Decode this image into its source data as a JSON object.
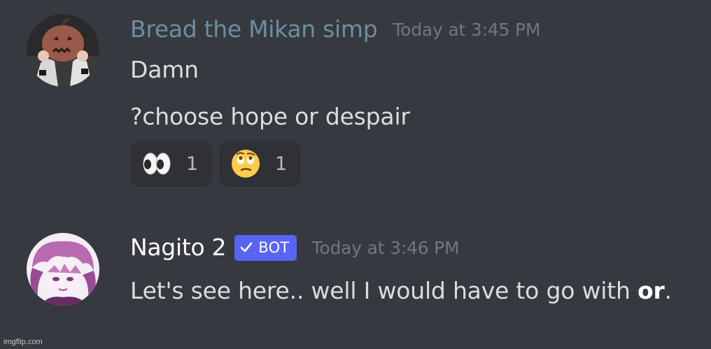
{
  "messages": [
    {
      "author": "Bread the Mikan simp",
      "author_color": "#6d8ea0",
      "timestamp": "Today at 3:45 PM",
      "avatar": "pumpkin-head-avatar",
      "lines": [
        "Damn",
        "?choose hope or despair"
      ],
      "reactions": [
        {
          "emoji": "eyes-emoji",
          "count": "1"
        },
        {
          "emoji": "face-with-rolling-eyes-emoji",
          "count": "1"
        }
      ]
    },
    {
      "author": "Nagito 2",
      "author_color": "#ffffff",
      "timestamp": "Today at 3:46 PM",
      "avatar": "anime-character-avatar",
      "badge": "BOT",
      "badge_icon": "checkmark-icon",
      "text_before": "Let's see here.. well I would have to go with ",
      "text_bold": "or",
      "text_after": "."
    }
  ],
  "watermark": "imgflip.com"
}
